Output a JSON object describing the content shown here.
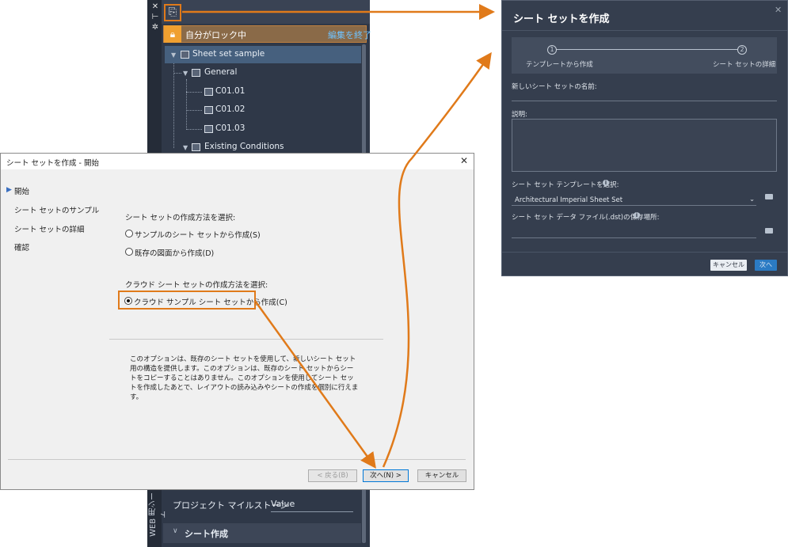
{
  "palette": {
    "lock_label": "自分がロック中",
    "lock_end": "編集を終了",
    "tree": {
      "root": "Sheet set sample",
      "group1": "General",
      "sheets": [
        "C01.01",
        "C01.02",
        "C01.03"
      ],
      "group2": "Existing Conditions"
    },
    "side_tab": "WEB 用シート",
    "milestone_label": "プロジェクト マイルストーン",
    "milestone_value": "Value",
    "create_section": "シート作成"
  },
  "dark_dialog": {
    "title": "シート セットを作成",
    "steps": [
      {
        "num": "1",
        "label": "テンプレートから作成"
      },
      {
        "num": "2",
        "label": "シート セットの詳細"
      }
    ],
    "name_label": "新しいシート セットの名前:",
    "desc_label": "説明:",
    "template_label": "シート セット テンプレートを選択:",
    "template_value": "Architectural Imperial Sheet Set",
    "dst_label": "シート セット データ ファイル(.dst)の保存場所:",
    "cancel": "キャンセル",
    "next": "次へ"
  },
  "wizard": {
    "title": "シート セットを作成 - 開始",
    "nav": [
      "開始",
      "シート セットのサンプル",
      "シート セットの詳細",
      "確認"
    ],
    "method_heading": "シート セットの作成方法を選択:",
    "options": [
      "サンプルのシート セットから作成(S)",
      "既存の図面から作成(D)"
    ],
    "cloud_heading": "クラウド シート セットの作成方法を選択:",
    "cloud_option": "クラウド サンプル シート セットから作成(C)",
    "description": "このオプションは、既存のシート セットを使用して、新しいシート セット用の構造を提供します。このオプションは、既存のシート セットからシートをコピーすることはありません。このオプションを使用してシート セットを作成したあとで、レイアウトの読み込みやシートの作成を個別に行えます。",
    "back": "< 戻る(B)",
    "next": "次へ(N) >",
    "cancel": "キャンセル"
  },
  "colors": {
    "arrow": "#e07a1a",
    "accent_blue": "#2b7bc4"
  }
}
